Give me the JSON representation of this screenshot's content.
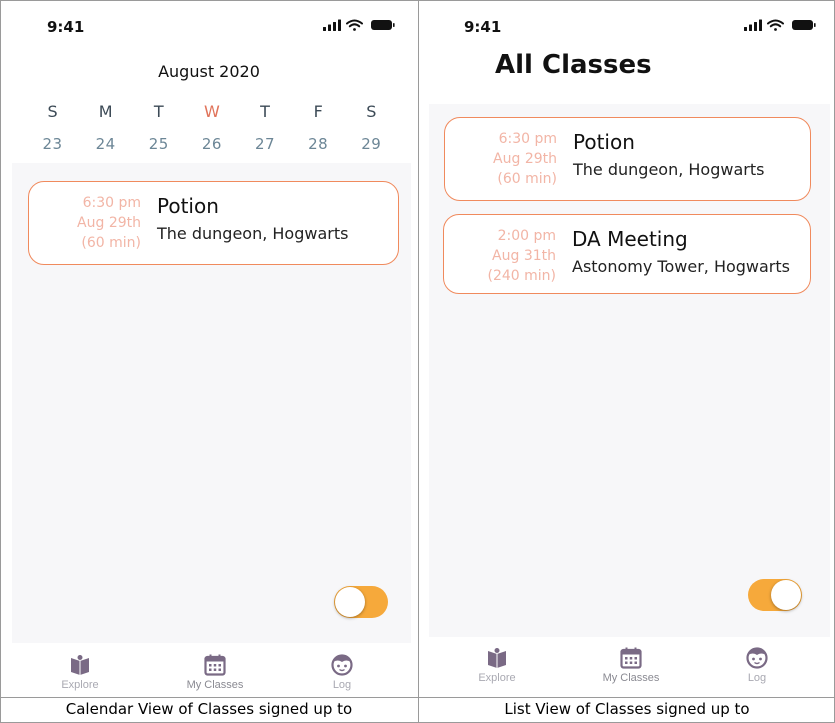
{
  "colors": {
    "accent_orange": "#f08a5d",
    "toggle_orange": "#f6a93b",
    "time_text": "#f2b5a6",
    "active_weekday": "#e0735a",
    "content_bg": "#f7f7f9",
    "tab_icon": "#7a6a85"
  },
  "calendar_view": {
    "status": {
      "time": "9:41"
    },
    "month_title": "August 2020",
    "weekdays": [
      "S",
      "M",
      "T",
      "W",
      "T",
      "F",
      "S"
    ],
    "dates": [
      "23",
      "24",
      "25",
      "26",
      "27",
      "28",
      "29"
    ],
    "active_weekday_index": 3,
    "classes": [
      {
        "time": "6:30 pm",
        "date": "Aug 29th",
        "duration": "(60 min)",
        "title": "Potion",
        "location": "The dungeon, Hogwarts"
      }
    ],
    "toggle": {
      "state": "off"
    },
    "tabs": [
      {
        "label": "Explore",
        "icon": "book-icon"
      },
      {
        "label": "My Classes",
        "icon": "calendar-icon"
      },
      {
        "label": "Log",
        "icon": "face-icon"
      }
    ],
    "caption": "Calendar View of Classes signed up to"
  },
  "list_view": {
    "status": {
      "time": "9:41"
    },
    "page_title": "All Classes",
    "classes": [
      {
        "time": "6:30 pm",
        "date": "Aug 29th",
        "duration": "(60 min)",
        "title": "Potion",
        "location": "The dungeon, Hogwarts"
      },
      {
        "time": "2:00 pm",
        "date": "Aug 31th",
        "duration": "(240 min)",
        "title": "DA Meeting",
        "location": "Astonomy Tower, Hogwarts"
      }
    ],
    "toggle": {
      "state": "on"
    },
    "tabs": [
      {
        "label": "Explore",
        "icon": "book-icon"
      },
      {
        "label": "My Classes",
        "icon": "calendar-icon"
      },
      {
        "label": "Log",
        "icon": "face-icon"
      }
    ],
    "caption": "List View of Classes signed up to"
  }
}
